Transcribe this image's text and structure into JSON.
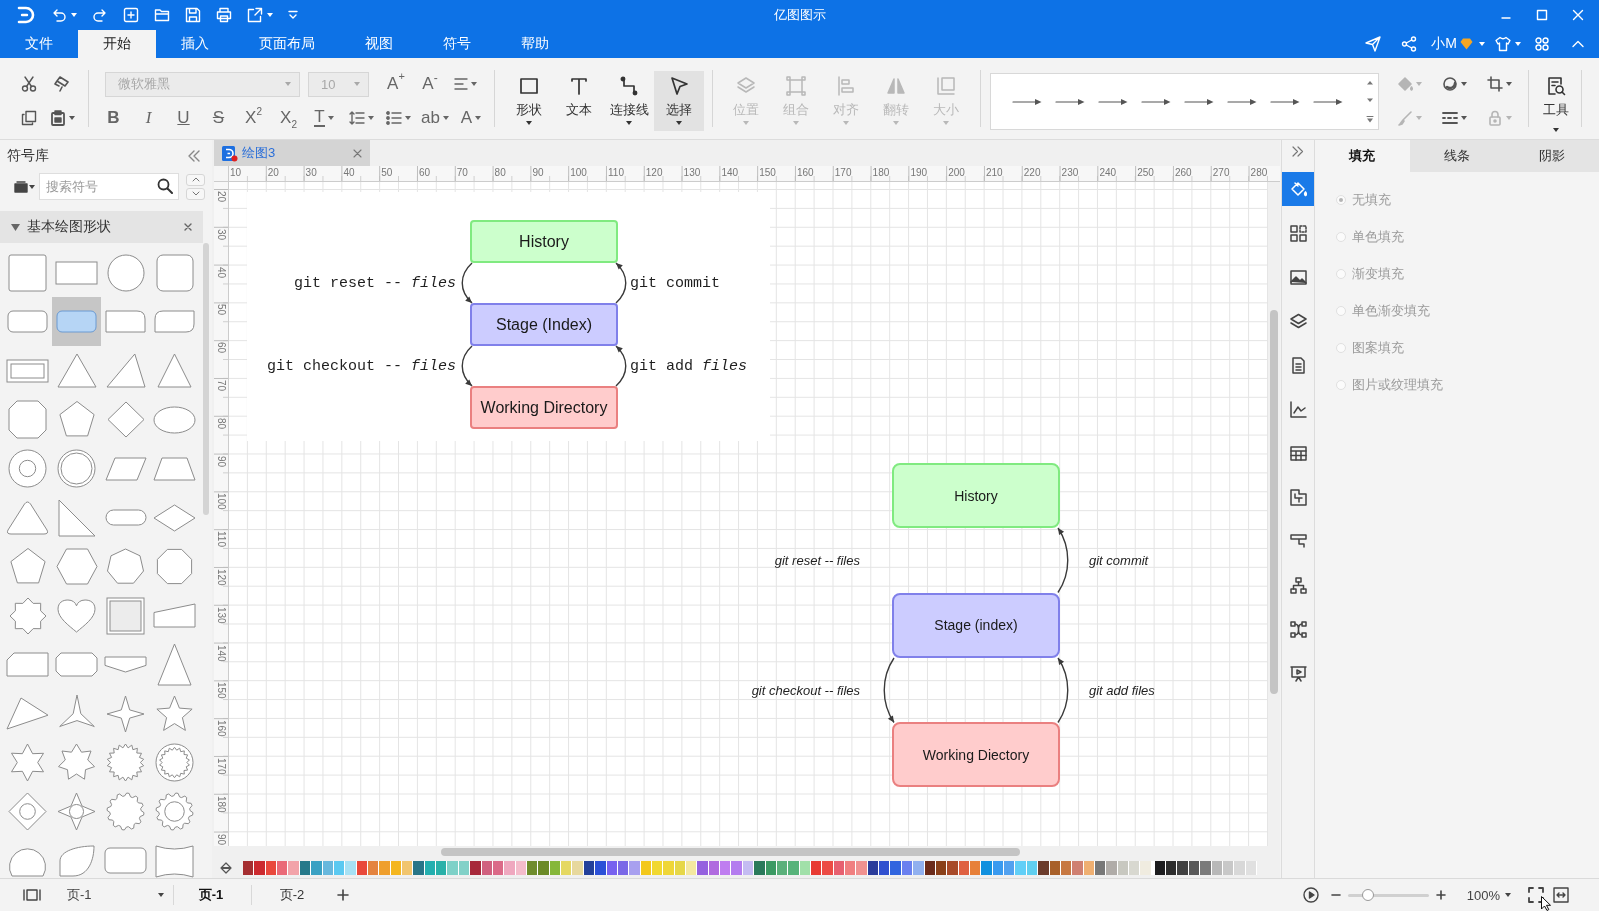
{
  "window": {
    "title": "亿图图示"
  },
  "menu": {
    "tabs": [
      {
        "label": "文件",
        "selected": false
      },
      {
        "label": "开始",
        "selected": true
      },
      {
        "label": "插入",
        "selected": false
      },
      {
        "label": "页面布局",
        "selected": false
      },
      {
        "label": "视图",
        "selected": false
      },
      {
        "label": "符号",
        "selected": false
      },
      {
        "label": "帮助",
        "selected": false
      }
    ],
    "account": {
      "name": "小M"
    }
  },
  "toolbar": {
    "font_family": {
      "value": "微软雅黑",
      "disabled": true
    },
    "font_size": {
      "value": "10",
      "disabled": true
    },
    "size_buttons": [
      {
        "kind": "grow",
        "glyph": "A$^{+}$"
      },
      {
        "kind": "shrink",
        "glyph": "A$^{-}$"
      }
    ],
    "format_buttons": [
      {
        "kind": "bold",
        "glyph": "B",
        "dropdown": false
      },
      {
        "kind": "italic",
        "glyph": "I",
        "dropdown": false
      },
      {
        "kind": "underline",
        "glyph": "U",
        "dropdown": false
      },
      {
        "kind": "strike",
        "glyph": "S",
        "dropdown": false
      },
      {
        "kind": "superscript",
        "glyph": "X$^{2}$",
        "dropdown": false
      },
      {
        "kind": "subscript",
        "glyph": "X$_{2}$",
        "dropdown": false
      },
      {
        "kind": "textstyle",
        "glyph": "T",
        "dropdown": true
      },
      {
        "kind": "linespacing",
        "dropdown": true
      },
      {
        "kind": "bullets",
        "dropdown": true
      },
      {
        "kind": "highlight",
        "glyph": "ab",
        "dropdown": true
      },
      {
        "kind": "fontcolor",
        "glyph": "A",
        "dropdown": true
      }
    ],
    "tools": [
      {
        "kind": "shape",
        "label": "形状",
        "dropdown": true,
        "selected": false
      },
      {
        "kind": "text",
        "label": "文本",
        "dropdown": false,
        "selected": false
      },
      {
        "kind": "connector",
        "label": "连接线",
        "dropdown": true,
        "selected": false
      },
      {
        "kind": "select",
        "label": "选择",
        "dropdown": true,
        "selected": true
      }
    ],
    "arrange_tools": [
      {
        "kind": "position",
        "label": "位置",
        "disabled": true
      },
      {
        "kind": "group",
        "label": "组合",
        "disabled": true
      },
      {
        "kind": "align",
        "label": "对齐",
        "disabled": true
      },
      {
        "kind": "flip",
        "label": "翻转",
        "disabled": true
      },
      {
        "kind": "size",
        "label": "大小",
        "disabled": true
      }
    ],
    "line_styles": [
      {
        "kind": "arrow"
      },
      {
        "kind": "arrow"
      },
      {
        "kind": "arrow"
      },
      {
        "kind": "arrow"
      },
      {
        "kind": "arrow"
      },
      {
        "kind": "arrow"
      },
      {
        "kind": "arrow"
      },
      {
        "kind": "arrow"
      }
    ],
    "style_tools": [
      {
        "kind": "fill",
        "disabled": true
      },
      {
        "kind": "effect",
        "disabled": false
      },
      {
        "kind": "crop",
        "disabled": false
      },
      {
        "kind": "pen",
        "disabled": true
      },
      {
        "kind": "dash",
        "disabled": false
      },
      {
        "kind": "lock",
        "disabled": true
      }
    ],
    "tools_button": {
      "label": "工具"
    }
  },
  "symbol_library": {
    "title": "符号库",
    "search": {
      "placeholder": "搜索符号"
    },
    "sections": [
      {
        "title": "基本绘图形状",
        "expanded": true,
        "shapes": [
          {
            "kind": "square",
            "selected": false
          },
          {
            "kind": "rectangle",
            "selected": false
          },
          {
            "kind": "circle",
            "selected": false
          },
          {
            "kind": "roundsquare",
            "selected": false
          },
          {
            "kind": "roundrect",
            "selected": false
          },
          {
            "kind": "roundrect",
            "selected": true
          },
          {
            "kind": "roundcorner",
            "selected": false
          },
          {
            "kind": "rounddiagonal",
            "selected": false
          },
          {
            "kind": "frame",
            "selected": false
          },
          {
            "kind": "triangle",
            "selected": false
          },
          {
            "kind": "scalene",
            "selected": false
          },
          {
            "kind": "narrowtriangle",
            "selected": false
          },
          {
            "kind": "chamfersquare",
            "selected": false
          },
          {
            "kind": "pentagon",
            "selected": false
          },
          {
            "kind": "diamond",
            "selected": false
          },
          {
            "kind": "ellipse",
            "selected": false
          },
          {
            "kind": "ring",
            "selected": false
          },
          {
            "kind": "doublecircle",
            "selected": false
          },
          {
            "kind": "parallelogram",
            "selected": false
          },
          {
            "kind": "trapezoid",
            "selected": false
          },
          {
            "kind": "roundtriangle",
            "selected": false
          },
          {
            "kind": "righttriangle",
            "selected": false
          },
          {
            "kind": "pill",
            "selected": false
          },
          {
            "kind": "flatdiamond",
            "selected": false
          },
          {
            "kind": "pentagon",
            "selected": false
          },
          {
            "kind": "hexagon",
            "selected": false
          },
          {
            "kind": "heptagon",
            "selected": false
          },
          {
            "kind": "octagon",
            "selected": false
          },
          {
            "kind": "wavystar",
            "selected": false
          },
          {
            "kind": "heart",
            "selected": false
          },
          {
            "kind": "bevel",
            "selected": false
          },
          {
            "kind": "wedge",
            "selected": false
          },
          {
            "kind": "snip",
            "selected": false
          },
          {
            "kind": "chamfer",
            "selected": false
          },
          {
            "kind": "banner",
            "selected": false
          },
          {
            "kind": "talltriangle",
            "selected": false
          },
          {
            "kind": "pointer",
            "selected": false
          },
          {
            "kind": "star3",
            "selected": false
          },
          {
            "kind": "star4",
            "selected": false
          },
          {
            "kind": "star5",
            "selected": false
          },
          {
            "kind": "star6",
            "selected": false
          },
          {
            "kind": "star7",
            "selected": false
          },
          {
            "kind": "seal",
            "selected": false
          },
          {
            "kind": "sealring",
            "selected": false
          },
          {
            "kind": "diamondring",
            "selected": false
          },
          {
            "kind": "star4ring",
            "selected": false
          },
          {
            "kind": "gear",
            "selected": false
          },
          {
            "kind": "gearring",
            "selected": false
          },
          {
            "kind": "arc",
            "selected": false
          },
          {
            "kind": "leaf",
            "selected": false
          },
          {
            "kind": "roundbox",
            "selected": false
          },
          {
            "kind": "wave",
            "selected": false
          }
        ]
      }
    ]
  },
  "documents": [
    {
      "title": "绘图3",
      "selected": true
    }
  ],
  "ruler": {
    "horizontal": [
      "10",
      "20",
      "30",
      "40",
      "50",
      "60",
      "70",
      "80",
      "90",
      "100",
      "110",
      "120",
      "130",
      "140",
      "150",
      "160",
      "170",
      "180",
      "190",
      "200",
      "210",
      "220",
      "230",
      "240",
      "250",
      "260",
      "270",
      "280"
    ],
    "vertical": [
      "20",
      "30",
      "40",
      "50",
      "60",
      "70",
      "80",
      "90",
      "100",
      "110",
      "120",
      "130",
      "140",
      "150",
      "160",
      "170",
      "180",
      "90"
    ]
  },
  "diagrams": [
    {
      "kind": "picture",
      "nodes": [
        {
          "label": "History",
          "color": "#ccffcc"
        },
        {
          "label": "Stage (Index)",
          "color": "#ccccff"
        },
        {
          "label": "Working Directory",
          "color": "#ffcccc"
        }
      ],
      "labels": [
        {
          "text": "git reset -- *files*",
          "arrow": true
        },
        {
          "text": "git commit",
          "arrow": true
        },
        {
          "text": "git checkout -- *files*",
          "arrow": true
        },
        {
          "text": "git add *files*",
          "arrow": true
        }
      ]
    },
    {
      "kind": "shapes",
      "nodes": [
        {
          "label": "History",
          "color": "#ccffcc"
        },
        {
          "label": "Stage (index)",
          "color": "#ccccff"
        },
        {
          "label": "Working Diectory",
          "color": "#ffcccc"
        }
      ],
      "labels": [
        {
          "text": "git reset -- files",
          "arrow": false
        },
        {
          "text": "git commit",
          "arrow": true
        },
        {
          "text": "git checkout -- files",
          "arrow": true
        },
        {
          "text": "git add files",
          "arrow": true
        }
      ]
    }
  ],
  "palette": [
    {
      "color": "#a52f31"
    },
    {
      "color": "#cc2a2f"
    },
    {
      "color": "#e9483c"
    },
    {
      "color": "#ea6977"
    },
    {
      "color": "#f2a3a9"
    },
    {
      "color": "#26798a"
    },
    {
      "color": "#3aa1c3"
    },
    {
      "color": "#68b8dd"
    },
    {
      "color": "#5bc9f1"
    },
    {
      "color": "#a7e1f4"
    },
    {
      "color": "#e9493a"
    },
    {
      "color": "#e4833e"
    },
    {
      "color": "#ef9f2d"
    },
    {
      "color": "#f4b61f"
    },
    {
      "color": "#f1c56e"
    },
    {
      "color": "#287587"
    },
    {
      "color": "#23afaf"
    },
    {
      "color": "#29b1a9"
    },
    {
      "color": "#7ed1c8"
    },
    {
      "color": "#82d1c8"
    },
    {
      "color": "#a7283a"
    },
    {
      "color": "#d0617f"
    },
    {
      "color": "#db6a88"
    },
    {
      "color": "#efa8bf"
    },
    {
      "color": "#f4bccb"
    },
    {
      "color": "#6f8c2c"
    },
    {
      "color": "#6b8a27"
    },
    {
      "color": "#86b73a"
    },
    {
      "color": "#e5d862"
    },
    {
      "color": "#e7d89d"
    },
    {
      "color": "#23409a"
    },
    {
      "color": "#2b50d7"
    },
    {
      "color": "#7761ef"
    },
    {
      "color": "#7a68e7"
    },
    {
      "color": "#a8a0ef"
    },
    {
      "color": "#f3c81c"
    },
    {
      "color": "#f1d830"
    },
    {
      "color": "#efd638"
    },
    {
      "color": "#e6d748"
    },
    {
      "color": "#f4e8a1"
    },
    {
      "color": "#9561df"
    },
    {
      "color": "#b06adf"
    },
    {
      "color": "#bf7df0"
    },
    {
      "color": "#b47cef"
    },
    {
      "color": "#c4bcf2"
    },
    {
      "color": "#2a7a5b"
    },
    {
      "color": "#3b9a63"
    },
    {
      "color": "#5ab07a"
    },
    {
      "color": "#57b37a"
    },
    {
      "color": "#a1e0a9"
    },
    {
      "color": "#e83a33"
    },
    {
      "color": "#ec4b45"
    },
    {
      "color": "#e76070"
    },
    {
      "color": "#f07f80"
    },
    {
      "color": "#f09190"
    },
    {
      "color": "#2a3b9a"
    },
    {
      "color": "#3050cf"
    },
    {
      "color": "#3165df"
    },
    {
      "color": "#6a80ef"
    },
    {
      "color": "#91b0ef"
    },
    {
      "color": "#6b2b1a"
    },
    {
      "color": "#8a4019"
    },
    {
      "color": "#a84a29"
    },
    {
      "color": "#df6041"
    },
    {
      "color": "#e78039"
    },
    {
      "color": "#1191df"
    },
    {
      "color": "#3a9aef"
    },
    {
      "color": "#52a1ef"
    },
    {
      "color": "#61cff7"
    },
    {
      "color": "#61cfef"
    },
    {
      "color": "#6b3b2b"
    },
    {
      "color": "#a86029"
    },
    {
      "color": "#c77841"
    },
    {
      "color": "#cf8071"
    },
    {
      "color": "#efaf71"
    },
    {
      "color": "#787878"
    },
    {
      "color": "#b0aca8"
    },
    {
      "color": "#c8c8c0"
    },
    {
      "color": "#d8d8d0"
    },
    {
      "color": "#f0ece0"
    },
    {
      "color": "#1c1c1e"
    },
    {
      "color": "#2c2c2c"
    },
    {
      "color": "#404040"
    },
    {
      "color": "#585858"
    },
    {
      "color": "#7a7a7a"
    },
    {
      "color": "#b8b8b8"
    },
    {
      "color": "#c8c8c8"
    },
    {
      "color": "#d8d8d8"
    },
    {
      "color": "#e0e0e0"
    }
  ],
  "side_tools": [
    {
      "kind": "fill",
      "selected": true
    },
    {
      "kind": "widgets",
      "selected": false
    },
    {
      "kind": "image",
      "selected": false
    },
    {
      "kind": "layers",
      "selected": false
    },
    {
      "kind": "document",
      "selected": false
    },
    {
      "kind": "chart",
      "selected": false
    },
    {
      "kind": "table",
      "selected": false
    },
    {
      "kind": "blocks",
      "selected": false
    },
    {
      "kind": "banner",
      "selected": false
    },
    {
      "kind": "hierarchy",
      "selected": false
    },
    {
      "kind": "mindmap",
      "selected": false
    },
    {
      "kind": "presentation",
      "selected": false
    }
  ],
  "format_panel": {
    "tabs": [
      {
        "label": "填充",
        "selected": true
      },
      {
        "label": "线条",
        "selected": false
      },
      {
        "label": "阴影",
        "selected": false
      }
    ],
    "fill_options": [
      {
        "label": "无填充",
        "selected": true,
        "disabled": true
      },
      {
        "label": "单色填充",
        "selected": false,
        "disabled": true
      },
      {
        "label": "渐变填充",
        "selected": false,
        "disabled": true
      },
      {
        "label": "单色渐变填充",
        "selected": false,
        "disabled": true
      },
      {
        "label": "图案填充",
        "selected": false,
        "disabled": true
      },
      {
        "label": "图片或纹理填充",
        "selected": false,
        "disabled": true
      }
    ]
  },
  "status_bar": {
    "page_select": {
      "value": "页-1"
    },
    "pages": [
      {
        "label": "页-1",
        "selected": true
      },
      {
        "label": "页-2",
        "selected": false
      }
    ],
    "zoom": {
      "level": 0.25,
      "value": "100%"
    }
  }
}
